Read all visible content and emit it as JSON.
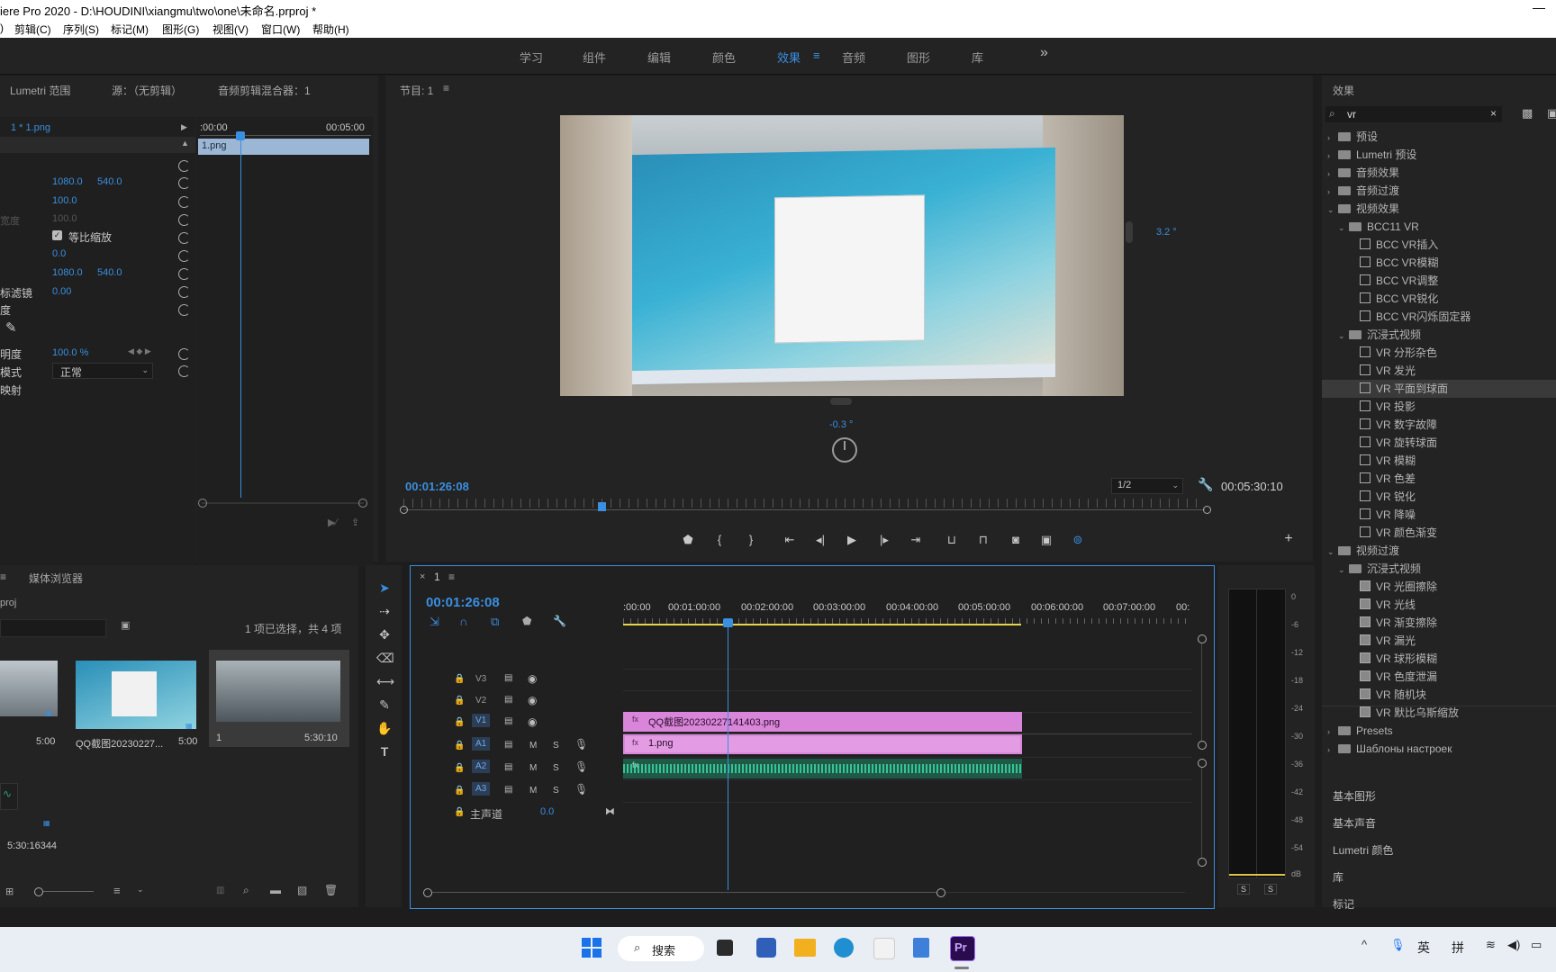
{
  "title": "iere Pro 2020 - D:\\HOUDINI\\xiangmu\\two\\one\\未命名.prproj *",
  "menu": [
    "剪辑(C)",
    "序列(S)",
    "标记(M)",
    "图形(G)",
    "视图(V)",
    "窗口(W)",
    "帮助(H)"
  ],
  "workspaces": [
    "学习",
    "组件",
    "编辑",
    "颜色",
    "效果",
    "音频",
    "图形",
    "库"
  ],
  "workspace_active": "效果",
  "workspace_more": "»",
  "source_tabs": [
    "Lumetri 范围",
    "源：（无剪辑）",
    "音频剪辑混合器：1"
  ],
  "ec": {
    "seq_label": "1 * 1.png",
    "time_start": ":00:00",
    "time_end": "00:05:00",
    "clip": "1.png",
    "position": [
      "1080.0",
      "540.0"
    ],
    "scale": "100.0",
    "scale_width": "100.0",
    "scale_width_label": "宽度",
    "uniform": "等比缩放",
    "rotation": "0.0",
    "anchor": [
      "1080.0",
      "540.0"
    ],
    "antiflicker_label": "标滤镜",
    "antiflicker": "0.00",
    "time_remap_label": "度",
    "opacity_label": "明度",
    "opacity": "100.0 %",
    "blend_label": "模式",
    "blend": "正常",
    "remap_label": "映射"
  },
  "program": {
    "title": "节目: 1",
    "timecode": "00:01:26:08",
    "duration": "00:05:30:10",
    "zoom": "1/2",
    "angle_right": "3.2 °",
    "angle_bottom": "-0.3 °"
  },
  "project": {
    "tab": "媒体浏览器",
    "name": "proj",
    "status": "1 项已选择，共 4 项",
    "items": [
      {
        "name": "",
        "dur": "5:00"
      },
      {
        "name": "QQ截图20230227...",
        "dur": "5:00"
      },
      {
        "name": "1",
        "dur": "5:30:10"
      }
    ],
    "audio_dur": "5:30:16344"
  },
  "timeline": {
    "tab": "1",
    "timecode": "00:01:26:08",
    "ruler": [
      ":00:00",
      "00:01:00:00",
      "00:02:00:00",
      "00:03:00:00",
      "00:04:00:00",
      "00:05:00:00",
      "00:06:00:00",
      "00:07:00:00",
      "00:"
    ],
    "video_tracks": [
      "V3",
      "V2",
      "V1"
    ],
    "audio_tracks": [
      "A1",
      "A2",
      "A3"
    ],
    "master_label": "主声道",
    "master_value": "0.0",
    "clip_v2": "QQ截图20230227141403.png",
    "clip_v1": "1.png"
  },
  "meter": {
    "scale": [
      "0",
      "-6",
      "-12",
      "-18",
      "-24",
      "-30",
      "-36",
      "-42",
      "-48",
      "-54",
      "dB"
    ],
    "solo": [
      "S",
      "S"
    ]
  },
  "effects": {
    "title": "效果",
    "search": "vr",
    "tree": [
      {
        "label": "预设",
        "type": "folder",
        "level": 0,
        "state": "closed"
      },
      {
        "label": "Lumetri 预设",
        "type": "folder",
        "level": 0,
        "state": "closed"
      },
      {
        "label": "音频效果",
        "type": "folder",
        "level": 0,
        "state": "closed"
      },
      {
        "label": "音频过渡",
        "type": "folder",
        "level": 0,
        "state": "closed"
      },
      {
        "label": "视频效果",
        "type": "folder",
        "level": 0,
        "state": "open"
      },
      {
        "label": "BCC11 VR",
        "type": "folder",
        "level": 1,
        "state": "open"
      },
      {
        "label": "BCC VR插入",
        "type": "fx",
        "level": 2
      },
      {
        "label": "BCC VR模糊",
        "type": "fx",
        "level": 2
      },
      {
        "label": "BCC VR调整",
        "type": "fx",
        "level": 2
      },
      {
        "label": "BCC VR锐化",
        "type": "fx",
        "level": 2
      },
      {
        "label": "BCC VR闪烁固定器",
        "type": "fx",
        "level": 2
      },
      {
        "label": "沉浸式视频",
        "type": "folder",
        "level": 1,
        "state": "open"
      },
      {
        "label": "VR 分形杂色",
        "type": "fx",
        "level": 2
      },
      {
        "label": "VR 发光",
        "type": "fx",
        "level": 2
      },
      {
        "label": "VR 平面到球面",
        "type": "fx",
        "level": 2,
        "selected": true
      },
      {
        "label": "VR 投影",
        "type": "fx",
        "level": 2
      },
      {
        "label": "VR 数字故障",
        "type": "fx",
        "level": 2
      },
      {
        "label": "VR 旋转球面",
        "type": "fx",
        "level": 2
      },
      {
        "label": "VR 模糊",
        "type": "fx",
        "level": 2
      },
      {
        "label": "VR 色差",
        "type": "fx",
        "level": 2
      },
      {
        "label": "VR 锐化",
        "type": "fx",
        "level": 2
      },
      {
        "label": "VR 降噪",
        "type": "fx",
        "level": 2
      },
      {
        "label": "VR 颜色渐变",
        "type": "fx",
        "level": 2
      },
      {
        "label": "视频过渡",
        "type": "folder",
        "level": 0,
        "state": "open"
      },
      {
        "label": "沉浸式视频",
        "type": "folder",
        "level": 1,
        "state": "open"
      },
      {
        "label": "VR 光圈擦除",
        "type": "tr",
        "level": 2
      },
      {
        "label": "VR 光线",
        "type": "tr",
        "level": 2
      },
      {
        "label": "VR 渐变擦除",
        "type": "tr",
        "level": 2
      },
      {
        "label": "VR 漏光",
        "type": "tr",
        "level": 2
      },
      {
        "label": "VR 球形模糊",
        "type": "tr",
        "level": 2
      },
      {
        "label": "VR 色度泄漏",
        "type": "tr",
        "level": 2
      },
      {
        "label": "VR 随机块",
        "type": "tr",
        "level": 2
      },
      {
        "label": "VR 默比乌斯缩放",
        "type": "tr",
        "level": 2
      },
      {
        "label": "Presets",
        "type": "folder",
        "level": 0,
        "state": "closed"
      },
      {
        "label": "Шаблоны настроек",
        "type": "folder",
        "level": 0,
        "state": "closed"
      }
    ],
    "panels": [
      "基本图形",
      "基本声音",
      "Lumetri 颜色",
      "库",
      "标记"
    ]
  },
  "taskbar": {
    "search": "搜索",
    "ime1": "英",
    "ime2": "拼",
    "app_pr": "Pr"
  },
  "colors": {
    "accent": "#3a8fe0",
    "clip_video": "#d985d9",
    "clip_audio": "#2e9a7a",
    "playhead": "#3a8fe0"
  }
}
